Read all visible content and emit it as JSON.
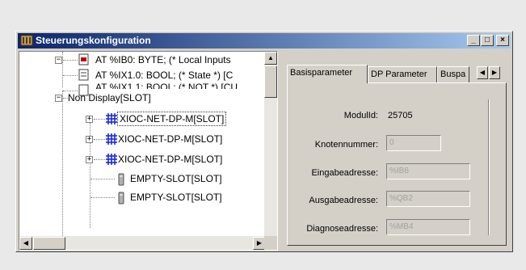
{
  "window": {
    "title": "Steuerungskonfiguration",
    "minimize": "_",
    "maximize": "□",
    "close": "×"
  },
  "tree": {
    "nodes": [
      {
        "label": "AT %IB0: BYTE; (* Local Inputs"
      },
      {
        "label": "AT %IX1.0: BOOL; (* State *) [C"
      },
      {
        "label": "AT %IX1.1: BOOL; (* NOT *) [CU"
      },
      {
        "label": "Non Display[SLOT]"
      },
      {
        "label": "XIOC-NET-DP-M[SLOT]"
      },
      {
        "label": "XIOC-NET-DP-M[SLOT]"
      },
      {
        "label": "XIOC-NET-DP-M[SLOT]"
      },
      {
        "label": "EMPTY-SLOT[SLOT]"
      },
      {
        "label": "EMPTY-SLOT[SLOT]"
      }
    ],
    "expanders": {
      "plus": "+",
      "minus": "−"
    }
  },
  "tabs": [
    {
      "label": "Basisparameter",
      "active": true
    },
    {
      "label": "DP Parameter",
      "active": false
    },
    {
      "label": "Buspa",
      "active": false
    }
  ],
  "fields": {
    "modulid": {
      "label": "ModulId:",
      "value": "25705"
    },
    "knotennummer": {
      "label": "Knotennummer:",
      "value": "0"
    },
    "eingabeadresse": {
      "label": "Eingabeadresse:",
      "value": "%IB6"
    },
    "ausgabeadresse": {
      "label": "Ausgabeadresse:",
      "value": "%QB2"
    },
    "diagnoseadresse": {
      "label": "Diagnoseadresse:",
      "value": "%MB4"
    }
  },
  "icons": {
    "app": "app-config-icon",
    "input_byte": "variable-byte-icon",
    "input_bool": "variable-bool-icon",
    "module": "network-module-icon",
    "slot": "empty-slot-icon"
  },
  "colors": {
    "titlebar_start": "#0a246a",
    "titlebar_end": "#a6caf0",
    "module_icon": "#1b2bd6"
  }
}
